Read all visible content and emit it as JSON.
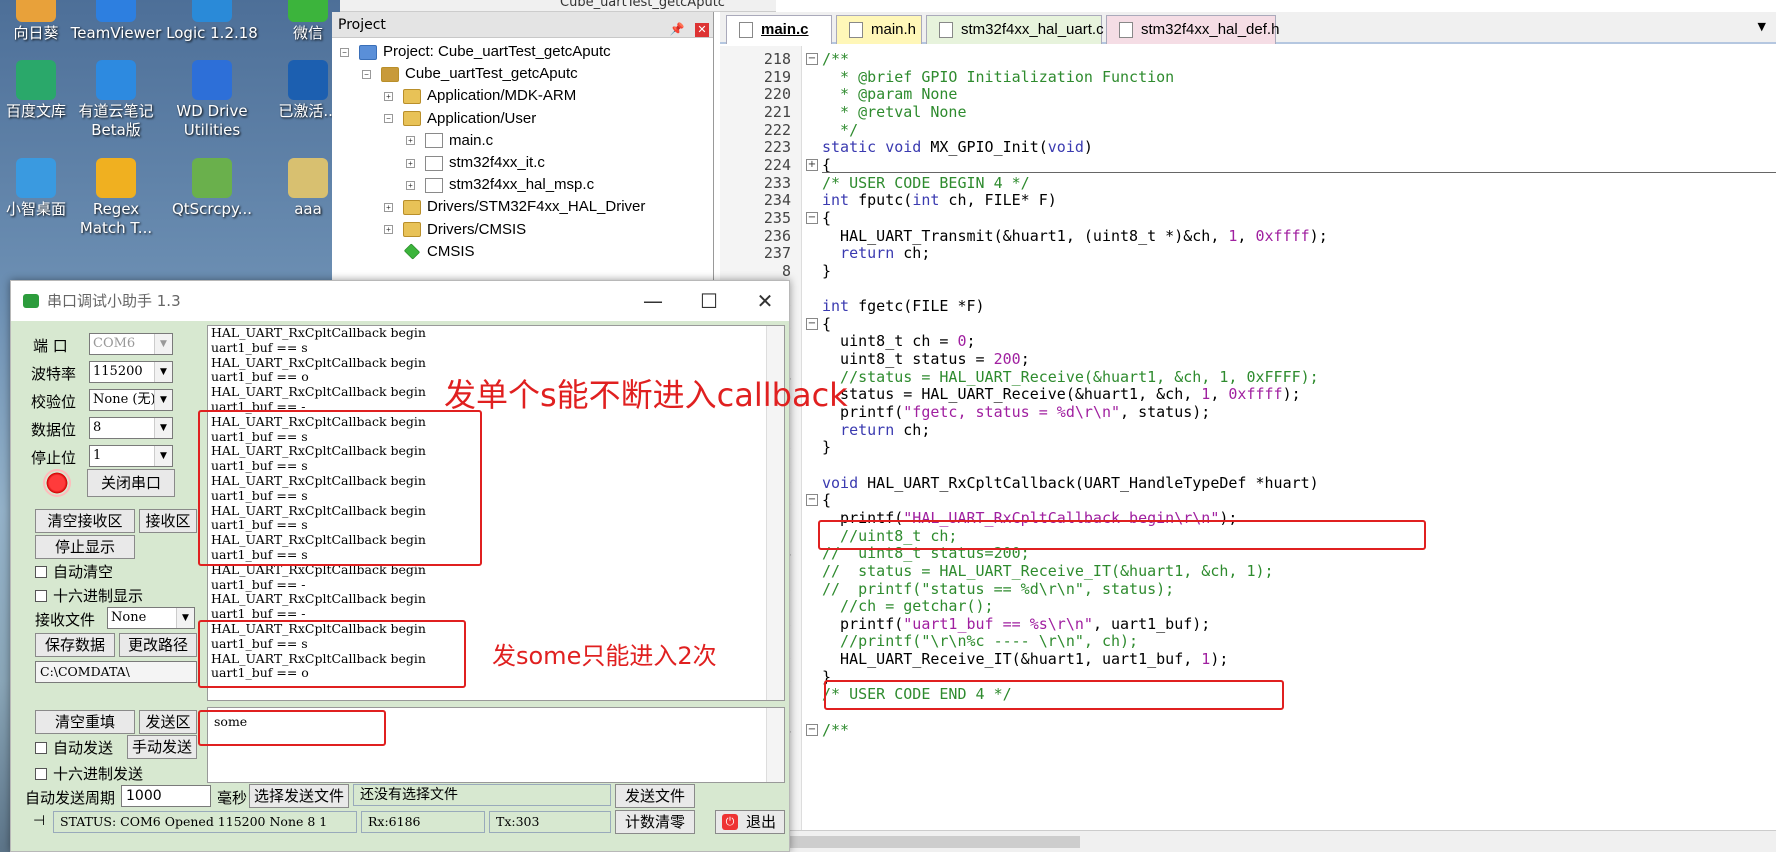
{
  "desktop": {
    "icons": [
      {
        "label": "向日葵"
      },
      {
        "label": "TeamViewer"
      },
      {
        "label": "Logic 1.2.18"
      },
      {
        "label": "微信"
      },
      {
        "label": "百度文库"
      },
      {
        "label": "有道云笔记\nBeta版"
      },
      {
        "label": "WD Drive\nUtilities"
      },
      {
        "label": "已激活..."
      },
      {
        "label": "小智桌面"
      },
      {
        "label": "Regex\nMatch T..."
      },
      {
        "label": "QtScrcpy..."
      },
      {
        "label": "aaa"
      }
    ]
  },
  "top_title": "Cube_uartTest_getcAputc",
  "project": {
    "header": "Project",
    "tree": [
      {
        "label": "Project: Cube_uartTest_getcAputc",
        "level": 0,
        "icon": "project-icon",
        "exp": "−"
      },
      {
        "label": "Cube_uartTest_getcAputc",
        "level": 1,
        "icon": "target-icon",
        "exp": "−"
      },
      {
        "label": "Application/MDK-ARM",
        "level": 2,
        "icon": "folder-icon",
        "exp": "+"
      },
      {
        "label": "Application/User",
        "level": 2,
        "icon": "folder-icon",
        "exp": "−"
      },
      {
        "label": "main.c",
        "level": 3,
        "icon": "file-icon",
        "exp": "+"
      },
      {
        "label": "stm32f4xx_it.c",
        "level": 3,
        "icon": "file-icon",
        "exp": "+"
      },
      {
        "label": "stm32f4xx_hal_msp.c",
        "level": 3,
        "icon": "file-icon",
        "exp": "+"
      },
      {
        "label": "Drivers/STM32F4xx_HAL_Driver",
        "level": 2,
        "icon": "folder-icon",
        "exp": "+"
      },
      {
        "label": "Drivers/CMSIS",
        "level": 2,
        "icon": "folder-icon",
        "exp": "+"
      },
      {
        "label": "CMSIS",
        "level": 2,
        "icon": "gem-icon",
        "exp": ""
      }
    ]
  },
  "editor": {
    "tabs": [
      {
        "label": "main.c",
        "color": "#ffffff",
        "active": true
      },
      {
        "label": "main.h",
        "color": "#fff7b8",
        "active": false
      },
      {
        "label": "stm32f4xx_hal_uart.c",
        "color": "#e7f3dc",
        "active": false
      },
      {
        "label": "stm32f4xx_hal_def.h",
        "color": "#f5dde5",
        "active": false
      }
    ],
    "lines": [
      {
        "n": "218",
        "html": "<span class=cm>/**</span>",
        "fold": "−"
      },
      {
        "n": "219",
        "html": "<span class=cm>  * @brief GPIO Initialization Function</span>"
      },
      {
        "n": "220",
        "html": "<span class=cm>  * @param None</span>"
      },
      {
        "n": "221",
        "html": "<span class=cm>  * @retval None</span>"
      },
      {
        "n": "222",
        "html": "<span class=cm>  */</span>"
      },
      {
        "n": "223",
        "html": "<span class=kw>static void</span> MX_GPIO_Init(<span class=kw>void</span>)"
      },
      {
        "n": "224",
        "html": "{",
        "fold": "+"
      },
      {
        "n": "233",
        "html": "<span class=cm>/* USER CODE BEGIN 4 */</span>"
      },
      {
        "n": "234",
        "html": "<span class=kw>int</span> fputc(<span class=kw>int</span> ch, FILE* F)"
      },
      {
        "n": "235",
        "html": "{",
        "fold": "−"
      },
      {
        "n": "236",
        "html": "  HAL_UART_Transmit(&amp;huart1, (uint8_t *)&amp;ch, <span class=num>1</span>, <span class=num>0xffff</span>);"
      },
      {
        "n": "237",
        "html": "  <span class=kw>return</span> ch;"
      },
      {
        "n": "8",
        "html": "}"
      },
      {
        "n": "9",
        "html": ""
      },
      {
        "n": "0",
        "html": "<span class=kw>int</span> fgetc(FILE *F)"
      },
      {
        "n": "1",
        "html": "{",
        "fold": "−"
      },
      {
        "n": "2",
        "html": "  uint8_t ch = <span class=num>0</span>;"
      },
      {
        "n": "3",
        "html": "  uint8_t status = <span class=num>200</span>;"
      },
      {
        "n": "4",
        "html": "<span class=cm>  //status = HAL_UART_Receive(&amp;huart1, &amp;ch, 1, 0xFFFF);</span>"
      },
      {
        "n": "5",
        "html": "  status = HAL_UART_Receive(&amp;huart1, &amp;ch, <span class=num>1</span>, <span class=num>0xffff</span>);"
      },
      {
        "n": "6",
        "html": "  printf(<span class=str>\"fgetc, status = %d\\r\\n\"</span>, status);"
      },
      {
        "n": "7",
        "html": "  <span class=kw>return</span> ch;"
      },
      {
        "n": "8",
        "html": "}"
      },
      {
        "n": "9",
        "html": ""
      },
      {
        "n": "0",
        "html": "<span class=kw>void</span> HAL_UART_RxCpltCallback(UART_HandleTypeDef *huart)"
      },
      {
        "n": "1",
        "html": "{",
        "fold": "−"
      },
      {
        "n": "2",
        "html": "  printf(<span class=str>\"HAL_UART_RxCpltCallback begin\\r\\n\"</span>);"
      },
      {
        "n": "3",
        "html": "<span class=cm>  //uint8_t ch;</span>"
      },
      {
        "n": "4",
        "html": "<span class=cm>//  uint8_t status=200;</span>"
      },
      {
        "n": "5",
        "html": "<span class=cm>//  status = HAL_UART_Receive_IT(&amp;huart1, &amp;ch, 1);</span>"
      },
      {
        "n": "6",
        "html": "<span class=cm>//  printf(\"status == %d\\r\\n\", status);</span>"
      },
      {
        "n": "7",
        "html": "<span class=cm>  //ch = getchar();</span>"
      },
      {
        "n": "8",
        "html": "  printf(<span class=str>\"uart1_buf == %s\\r\\n\"</span>, uart1_buf);"
      },
      {
        "n": "9",
        "html": "<span class=cm>  //printf(\"\\r\\n%c ---- \\r\\n\", ch);</span>"
      },
      {
        "n": "0",
        "html": "  HAL_UART_Receive_IT(&amp;huart1, uart1_buf, <span class=num>1</span>);"
      },
      {
        "n": "1",
        "html": "}"
      },
      {
        "n": "2",
        "html": "<span class=cm>/* USER CODE END 4 */</span>"
      },
      {
        "n": "3",
        "html": ""
      },
      {
        "n": "4",
        "html": "<span class=cm>/**</span>",
        "fold": "−"
      }
    ]
  },
  "serial": {
    "title": "串口调试小助手 1.3",
    "minimize": "—",
    "maximize": "☐",
    "close": "✕",
    "port_label": "端  口",
    "port_value": "COM6",
    "baud_label": "波特率",
    "baud_value": "115200",
    "parity_label": "校验位",
    "parity_value": "None (无)",
    "data_label": "数据位",
    "data_value": "8",
    "stop_label": "停止位",
    "stop_value": "1",
    "close_port": "关闭串口",
    "clear_recv": "清空接收区",
    "recv_area": "接收区",
    "stop_display": "停止显示",
    "auto_clear": "自动清空",
    "hex_display": "十六进制显示",
    "recv_file_label": "接收文件",
    "recv_file_value": "None",
    "save_data": "保存数据",
    "change_path": "更改路径",
    "path": "C:\\COMDATA\\",
    "recv_lines": [
      "HAL_UART_RxCpltCallback begin",
      "uart1_buf == s",
      "HAL_UART_RxCpltCallback begin",
      "uart1_buf == o",
      "HAL_UART_RxCpltCallback begin",
      "uart1_buf == -",
      "HAL_UART_RxCpltCallback begin",
      "uart1_buf == s",
      "HAL_UART_RxCpltCallback begin",
      "uart1_buf == s",
      "HAL_UART_RxCpltCallback begin",
      "uart1_buf == s",
      "HAL_UART_RxCpltCallback begin",
      "uart1_buf == s",
      "HAL_UART_RxCpltCallback begin",
      "uart1_buf == s",
      "HAL_UART_RxCpltCallback begin",
      "uart1_buf == -",
      "HAL_UART_RxCpltCallback begin",
      "uart1_buf == -",
      "HAL_UART_RxCpltCallback begin",
      "uart1_buf == s",
      "HAL_UART_RxCpltCallback begin",
      "uart1_buf == o"
    ],
    "send_text": "some",
    "clear_reset": "清空重填",
    "send_area": "发送区",
    "auto_send": "自动发送",
    "manual_send": "手动发送",
    "hex_send": "十六进制发送",
    "period_label": "自动发送周期",
    "period_value": "1000",
    "ms_label": "毫秒",
    "choose_file": "选择发送文件",
    "no_file": "还没有选择文件",
    "send_file": "发送文件",
    "status": "STATUS: COM6 Opened 115200 None  8 1",
    "rx": "Rx:6186",
    "tx": "Tx:303",
    "count_clear": "计数清零",
    "exit": "退出"
  },
  "annotations": {
    "single_s": "发单个s能不断进入callback",
    "some_twice": "发some只能进入2次"
  }
}
